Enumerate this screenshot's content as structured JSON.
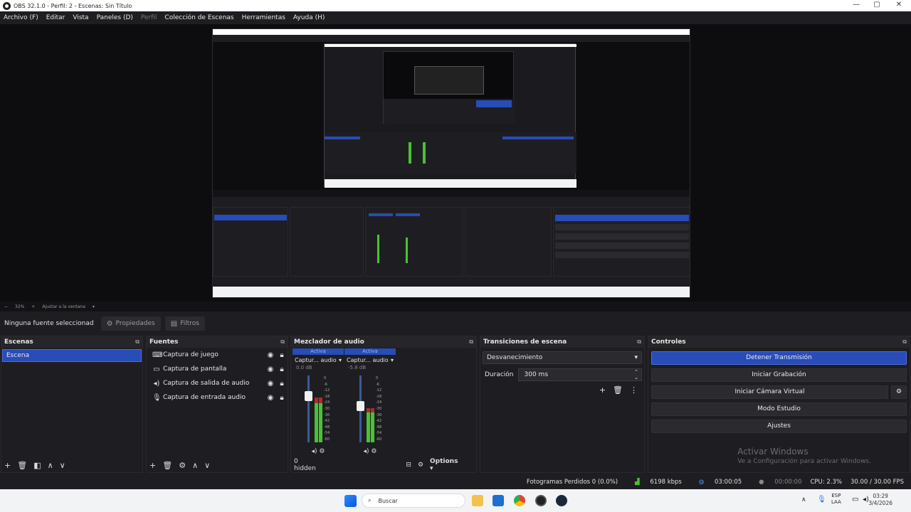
{
  "window": {
    "title": "OBS 32.1.0 - Perfil: 2 - Escenas: Sin Título",
    "minimize": "—",
    "maximize": "▢",
    "close": "✕"
  },
  "menu": {
    "items": [
      "Archivo (F)",
      "Editar",
      "Vista",
      "Paneles (D)",
      "Perfil",
      "Colección de Escenas",
      "Herramientas",
      "Ayuda (H)"
    ]
  },
  "zoombar": {
    "minus": "−",
    "zoom": "32%",
    "plus": "+",
    "fit": "Ajustar a la ventana"
  },
  "source_bar": {
    "no_source": "Ninguna fuente seleccionad",
    "properties": "Propiedades",
    "filters": "Filtros"
  },
  "scenes": {
    "title": "Escenas",
    "items": [
      "Escena"
    ]
  },
  "sources": {
    "title": "Fuentes",
    "items": [
      {
        "label": "Captura de juego",
        "icon": "gamepad-icon"
      },
      {
        "label": "Captura de pantalla",
        "icon": "monitor-icon"
      },
      {
        "label": "Captura de salida de audio",
        "icon": "speaker-icon"
      },
      {
        "label": "Captura de entrada audio",
        "icon": "microphone-icon"
      }
    ]
  },
  "mixer": {
    "title": "Mezclador de audio",
    "channels": [
      {
        "active": "Activa",
        "name": "Captur... audio",
        "db": "0.0 dB",
        "level": 0.72
      },
      {
        "active": "Activa",
        "name": "Captur... audio",
        "db": "-5.8 dB",
        "level": 0.55
      }
    ],
    "ticks": [
      "0",
      "-6",
      "-12",
      "-18",
      "-24",
      "-30",
      "-36",
      "-42",
      "-48",
      "-54",
      "-60"
    ],
    "hidden": "0 hidden",
    "options": "Options"
  },
  "transitions": {
    "title": "Transiciones de escena",
    "type": "Desvanecimiento",
    "duration_label": "Duración",
    "duration_value": "300 ms"
  },
  "controls": {
    "title": "Controles",
    "buttons": [
      "Detener Transmisión",
      "Iniciar Grabación",
      "Iniciar Cámara Virtual",
      "Modo Estudio",
      "Ajustes"
    ],
    "activate_title": "Activar Windows",
    "activate_sub": "Ve a Configuración para activar Windows."
  },
  "status": {
    "dropped": "Fotogramas Perdidos 0 (0.0%)",
    "bitrate": "6198 kbps",
    "stream_time": "03:00:05",
    "rec_time": "00:00:00",
    "cpu": "CPU: 2.3%",
    "fps": "30.00 / 30.00 FPS"
  },
  "taskbar": {
    "search": "Buscar",
    "lang1": "ESP",
    "lang2": "LAA",
    "time": "03:29",
    "date": "3/4/2026"
  },
  "colors": {
    "accent": "#284cb8",
    "panel": "#1e1e22",
    "meter_green": "#49c233",
    "meter_red": "#b02a2a"
  }
}
